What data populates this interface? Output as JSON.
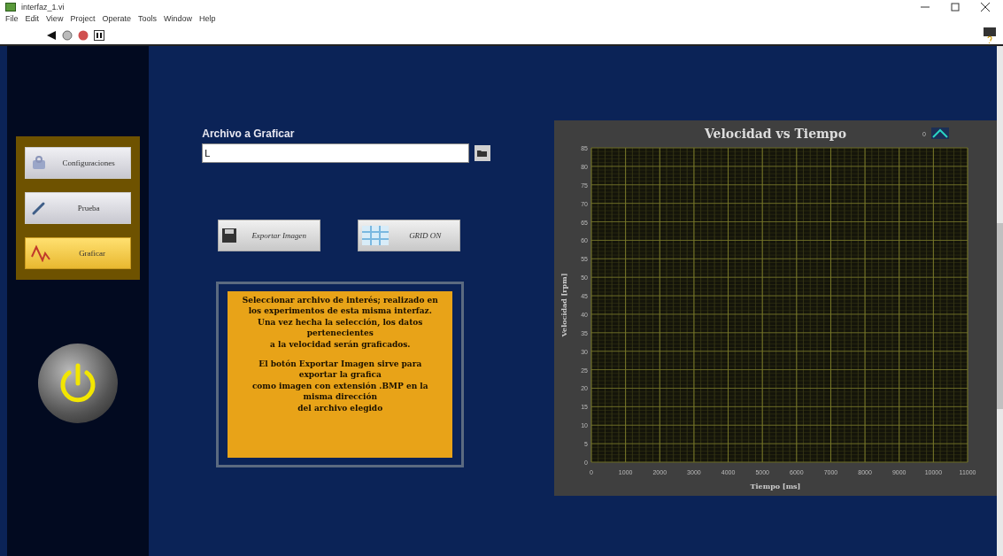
{
  "window": {
    "title": "interfaz_1.vi"
  },
  "menu": [
    "File",
    "Edit",
    "View",
    "Project",
    "Operate",
    "Tools",
    "Window",
    "Help"
  ],
  "sidebar": {
    "buttons": [
      {
        "label": "Configuraciones",
        "kind": "settings",
        "selected": false
      },
      {
        "label": "Prueba",
        "kind": "test",
        "selected": false
      },
      {
        "label": "Graficar",
        "kind": "graph",
        "selected": true
      }
    ]
  },
  "file_path": {
    "label": "Archivo a Graficar",
    "value": "L"
  },
  "buttons": [
    {
      "label": "Exportar Imagen",
      "kind": "save"
    },
    {
      "label": "GRID ON",
      "kind": "grid"
    }
  ],
  "info_text": [
    [
      "Seleccionar archivo de interés; realizado en los experimentos de esta misma interfaz.",
      "Una vez hecha la selección, los datos pertenecientes",
      "a la velocidad serán graficados."
    ],
    [
      "El botón Exportar Imagen sirve para exportar la grafica",
      "como imagen con extensión .BMP en la misma dirección",
      "del archivo elegido"
    ]
  ],
  "chart": {
    "legend": "0",
    "chart_data": {
      "type": "line",
      "grid": true,
      "title": "Velocidad vs Tiempo",
      "xlabel": "Tiempo [ms]",
      "ylabel": "Velocidad [rpm]",
      "xlim": [
        0,
        11000
      ],
      "ylim": [
        0,
        85
      ],
      "xticks": [
        0,
        1000,
        2000,
        3000,
        4000,
        5000,
        6000,
        7000,
        8000,
        9000,
        10000,
        11000
      ],
      "yticks": [
        0,
        5,
        10,
        15,
        20,
        25,
        30,
        35,
        40,
        45,
        50,
        55,
        60,
        65,
        70,
        75,
        80,
        85
      ]
    }
  }
}
